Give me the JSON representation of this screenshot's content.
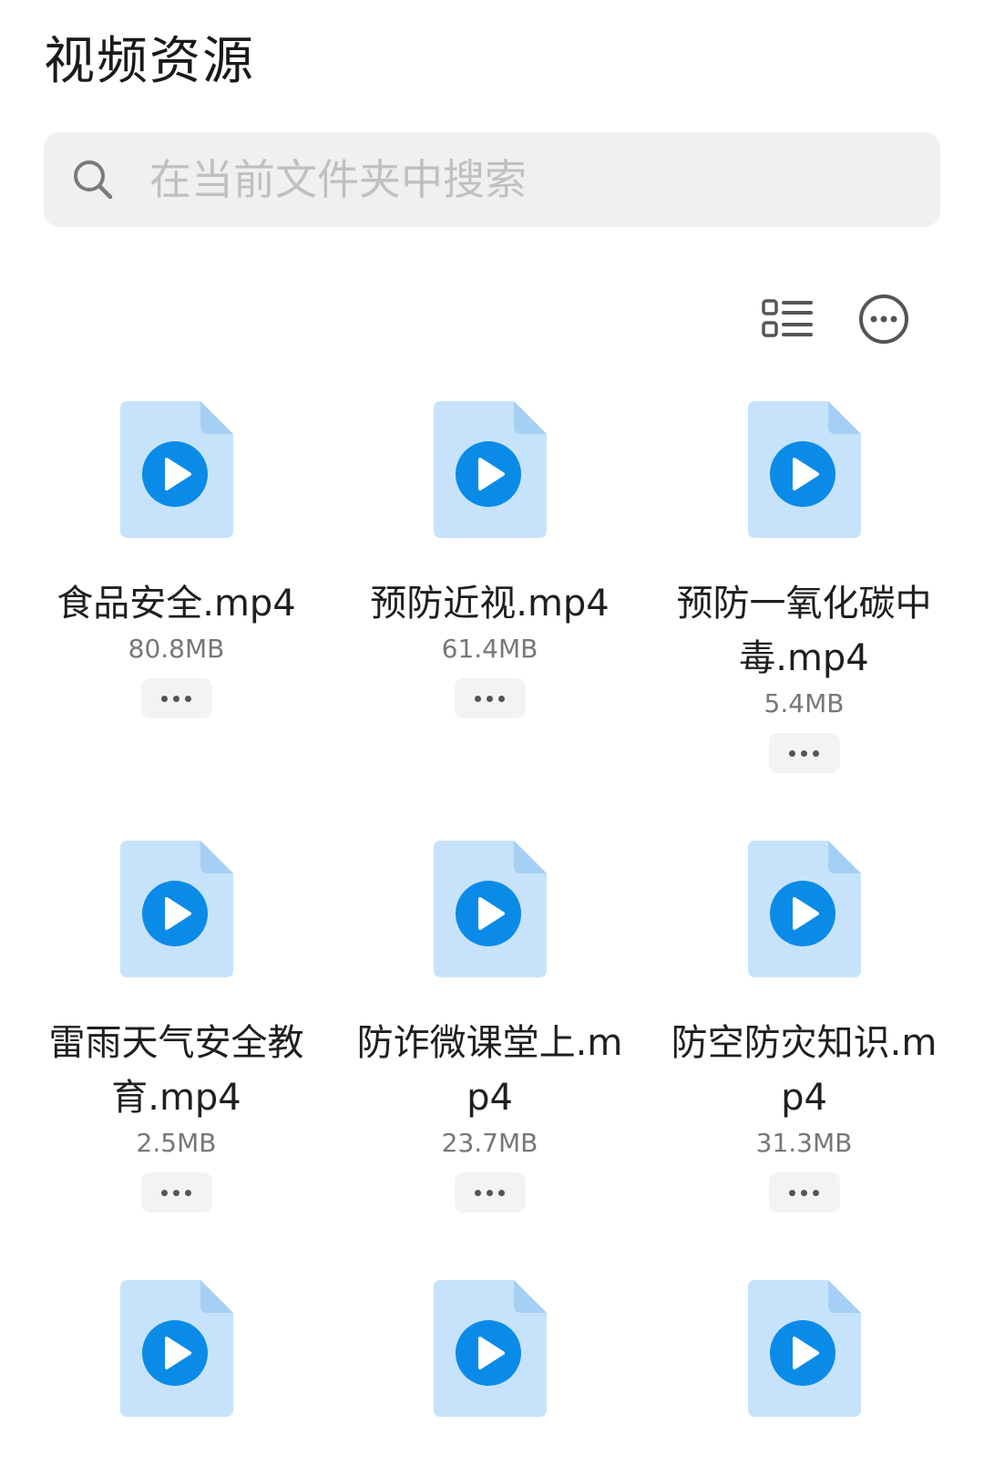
{
  "header": {
    "title": "视频资源"
  },
  "search": {
    "placeholder": "在当前文件夹中搜索"
  },
  "toolbar": {
    "view_toggle_icon": "list-view-icon",
    "more_icon": "more-circle-icon"
  },
  "colors": {
    "file_icon_bg": "#c7e3fb",
    "file_icon_fold": "#a6cff6",
    "play_button": "#0b8be8",
    "search_bg": "#f0f0f0",
    "placeholder": "#c0c0c0"
  },
  "files": [
    {
      "name": "食品安全.mp4",
      "size": "80.8MB",
      "icon": "video-file-icon"
    },
    {
      "name": "预防近视.mp4",
      "size": "61.4MB",
      "icon": "video-file-icon"
    },
    {
      "name": "预防一氧化碳中毒.mp4",
      "size": "5.4MB",
      "icon": "video-file-icon"
    },
    {
      "name": "雷雨天气安全教育.mp4",
      "size": "2.5MB",
      "icon": "video-file-icon"
    },
    {
      "name": "防诈微课堂上.mp4",
      "size": "23.7MB",
      "icon": "video-file-icon"
    },
    {
      "name": "防空防灾知识.mp4",
      "size": "31.3MB",
      "icon": "video-file-icon"
    },
    {
      "name": "",
      "size": "",
      "icon": "video-file-icon"
    },
    {
      "name": "",
      "size": "",
      "icon": "video-file-icon"
    },
    {
      "name": "",
      "size": "",
      "icon": "video-file-icon"
    }
  ]
}
